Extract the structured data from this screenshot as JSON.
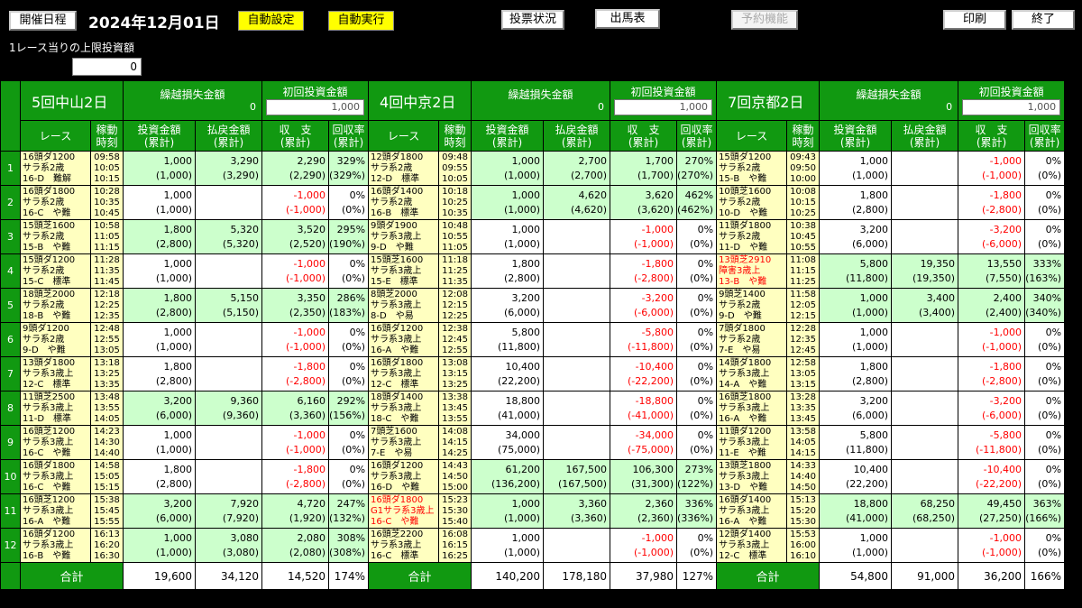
{
  "toolbar": {
    "schedule": "開催日程",
    "date": "2024年12月01日",
    "auto_set": "自動設定",
    "auto_run": "自動実行",
    "bet_status": "投票状況",
    "entries": "出馬表",
    "reserve": "予約機能",
    "print": "印刷",
    "exit": "終了",
    "limit_label": "1レース当りの上限投資額",
    "limit_value": "0"
  },
  "headers": {
    "carry_loss": "繰越損失金額",
    "first_bet": "初回投資金額",
    "race": "レース",
    "time": "稼動\n時刻",
    "invest": "投資金額\n(累計)",
    "payout": "払戻金額\n(累計)",
    "balance": "収　支\n(累計)",
    "rate": "回収率\n(累計)",
    "total": "合計"
  },
  "row_numbers": [
    "1",
    "2",
    "3",
    "4",
    "5",
    "6",
    "7",
    "8",
    "9",
    "10",
    "11",
    "12"
  ],
  "venues": [
    {
      "name": "5回中山2日",
      "carry": "0",
      "first": "1,000",
      "rows": [
        {
          "race": "16頭ダ1200\nサラ系2歳\n16-D　難解",
          "time": "09:58\n10:05\n10:15",
          "inv": "1,000\n(1,000)",
          "pay": "3,290\n(3,290)",
          "bal": "2,290\n(2,290)",
          "rate": "329%\n(329%)",
          "neg": false,
          "hit": true,
          "red": false
        },
        {
          "race": "16頭ダ1800\nサラ系2歳\n16-C　や難",
          "time": "10:28\n10:35\n10:45",
          "inv": "1,000\n(1,000)",
          "pay": "",
          "bal": "-1,000\n(-1,000)",
          "rate": "0%\n(0%)",
          "neg": true,
          "hit": false,
          "red": false
        },
        {
          "race": "15頭芝1600\nサラ系2歳\n15-B　や難",
          "time": "10:58\n11:05\n11:15",
          "inv": "1,800\n(2,800)",
          "pay": "5,320\n(5,320)",
          "bal": "3,520\n(2,520)",
          "rate": "295%\n(190%)",
          "neg": false,
          "hit": true,
          "red": false
        },
        {
          "race": "15頭ダ1200\nサラ系2歳\n15-C　標準",
          "time": "11:28\n11:35\n11:45",
          "inv": "1,000\n(1,000)",
          "pay": "",
          "bal": "-1,000\n(-1,000)",
          "rate": "0%\n(0%)",
          "neg": true,
          "hit": false,
          "red": false
        },
        {
          "race": "18頭芝2000\nサラ系2歳\n18-B　や難",
          "time": "12:18\n12:25\n12:35",
          "inv": "1,800\n(2,800)",
          "pay": "5,150\n(5,150)",
          "bal": "3,350\n(2,350)",
          "rate": "286%\n(183%)",
          "neg": false,
          "hit": true,
          "red": false
        },
        {
          "race": "9頭ダ1200\nサラ系2歳\n9-D　や難",
          "time": "12:48\n12:55\n13:05",
          "inv": "1,000\n(1,000)",
          "pay": "",
          "bal": "-1,000\n(-1,000)",
          "rate": "0%\n(0%)",
          "neg": true,
          "hit": false,
          "red": false
        },
        {
          "race": "13頭ダ1800\nサラ系3歳上\n12-C　標準",
          "time": "13:18\n13:25\n13:35",
          "inv": "1,800\n(2,800)",
          "pay": "",
          "bal": "-1,800\n(-2,800)",
          "rate": "0%\n(0%)",
          "neg": true,
          "hit": false,
          "red": false
        },
        {
          "race": "11頭芝2500\nサラ系3歳上\n11-D　標準",
          "time": "13:48\n13:55\n14:05",
          "inv": "3,200\n(6,000)",
          "pay": "9,360\n(9,360)",
          "bal": "6,160\n(3,360)",
          "rate": "292%\n(156%)",
          "neg": false,
          "hit": true,
          "red": false
        },
        {
          "race": "16頭芝1200\nサラ系3歳上\n16-C　や難",
          "time": "14:23\n14:30\n14:40",
          "inv": "1,000\n(1,000)",
          "pay": "",
          "bal": "-1,000\n(-1,000)",
          "rate": "0%\n(0%)",
          "neg": true,
          "hit": false,
          "red": false
        },
        {
          "race": "16頭ダ1800\nサラ系3歳上\n16-C　や難",
          "time": "14:58\n15:05\n15:15",
          "inv": "1,800\n(2,800)",
          "pay": "",
          "bal": "-1,800\n(-2,800)",
          "rate": "0%\n(0%)",
          "neg": true,
          "hit": false,
          "red": false
        },
        {
          "race": "16頭芝1200\nサラ系3歳上\n16-A　や難",
          "time": "15:38\n15:45\n15:55",
          "inv": "3,200\n(6,000)",
          "pay": "7,920\n(7,920)",
          "bal": "4,720\n(1,920)",
          "rate": "247%\n(132%)",
          "neg": false,
          "hit": true,
          "red": false
        },
        {
          "race": "16頭ダ1200\nサラ系3歳上\n16-B　や難",
          "time": "16:13\n16:20\n16:30",
          "inv": "1,000\n(1,000)",
          "pay": "3,080\n(3,080)",
          "bal": "2,080\n(2,080)",
          "rate": "308%\n(308%)",
          "neg": false,
          "hit": true,
          "red": false
        }
      ],
      "totals": {
        "inv": "19,600",
        "pay": "34,120",
        "bal": "14,520",
        "rate": "174%"
      }
    },
    {
      "name": "4回中京2日",
      "carry": "0",
      "first": "1,000",
      "rows": [
        {
          "race": "12頭ダ1800\nサラ系2歳\n12-D　標準",
          "time": "09:48\n09:55\n10:05",
          "inv": "1,000\n(1,000)",
          "pay": "2,700\n(2,700)",
          "bal": "1,700\n(1,700)",
          "rate": "270%\n(270%)",
          "neg": false,
          "hit": true,
          "red": false
        },
        {
          "race": "16頭ダ1400\nサラ系2歳\n16-B　標準",
          "time": "10:18\n10:25\n10:35",
          "inv": "1,000\n(1,000)",
          "pay": "4,620\n(4,620)",
          "bal": "3,620\n(3,620)",
          "rate": "462%\n(462%)",
          "neg": false,
          "hit": true,
          "red": false
        },
        {
          "race": "9頭ダ1900\nサラ系3歳上\n9-D　や難",
          "time": "10:48\n10:55\n11:05",
          "inv": "1,000\n(1,000)",
          "pay": "",
          "bal": "-1,000\n(-1,000)",
          "rate": "0%\n(0%)",
          "neg": true,
          "hit": false,
          "red": false
        },
        {
          "race": "15頭芝1600\nサラ系3歳上\n15-E　標準",
          "time": "11:18\n11:25\n11:35",
          "inv": "1,800\n(2,800)",
          "pay": "",
          "bal": "-1,800\n(-2,800)",
          "rate": "0%\n(0%)",
          "neg": true,
          "hit": false,
          "red": false
        },
        {
          "race": "8頭芝2000\nサラ系3歳上\n8-D　や易",
          "time": "12:08\n12:15\n12:25",
          "inv": "3,200\n(6,000)",
          "pay": "",
          "bal": "-3,200\n(-6,000)",
          "rate": "0%\n(0%)",
          "neg": true,
          "hit": false,
          "red": false
        },
        {
          "race": "16頭ダ1200\nサラ系3歳上\n16-A　や難",
          "time": "12:38\n12:45\n12:55",
          "inv": "5,800\n(11,800)",
          "pay": "",
          "bal": "-5,800\n(-11,800)",
          "rate": "0%\n(0%)",
          "neg": true,
          "hit": false,
          "red": false
        },
        {
          "race": "16頭ダ1800\nサラ系3歳上\n12-C　標準",
          "time": "13:08\n13:15\n13:25",
          "inv": "10,400\n(22,200)",
          "pay": "",
          "bal": "-10,400\n(-22,200)",
          "rate": "0%\n(0%)",
          "neg": true,
          "hit": false,
          "red": false
        },
        {
          "race": "18頭ダ1400\nサラ系3歳上\n18-C　や難",
          "time": "13:38\n13:45\n13:55",
          "inv": "18,800\n(41,000)",
          "pay": "",
          "bal": "-18,800\n(-41,000)",
          "rate": "0%\n(0%)",
          "neg": true,
          "hit": false,
          "red": false
        },
        {
          "race": "7頭芝1600\nサラ系3歳上\n7-E　や易",
          "time": "14:08\n14:15\n14:25",
          "inv": "34,000\n(75,000)",
          "pay": "",
          "bal": "-34,000\n(-75,000)",
          "rate": "0%\n(0%)",
          "neg": true,
          "hit": false,
          "red": false
        },
        {
          "race": "16頭ダ1200\nサラ系3歳上\n16-D　や難",
          "time": "14:43\n14:50\n15:00",
          "inv": "61,200\n(136,200)",
          "pay": "167,500\n(167,500)",
          "bal": "106,300\n(31,300)",
          "rate": "273%\n(122%)",
          "neg": false,
          "hit": true,
          "red": false
        },
        {
          "race": "16頭ダ1800\nG1サラ系3歳上\n16-C　や難",
          "time": "15:23\n15:30\n15:40",
          "inv": "1,000\n(1,000)",
          "pay": "3,360\n(3,360)",
          "bal": "2,360\n(2,360)",
          "rate": "336%\n(336%)",
          "neg": false,
          "hit": true,
          "red": true
        },
        {
          "race": "16頭芝2200\nサラ系3歳上\n16-C　標準",
          "time": "16:08\n16:15\n16:25",
          "inv": "1,000\n(1,000)",
          "pay": "",
          "bal": "-1,000\n(-1,000)",
          "rate": "0%\n(0%)",
          "neg": true,
          "hit": false,
          "red": false
        }
      ],
      "totals": {
        "inv": "140,200",
        "pay": "178,180",
        "bal": "37,980",
        "rate": "127%"
      }
    },
    {
      "name": "7回京都2日",
      "carry": "0",
      "first": "1,000",
      "rows": [
        {
          "race": "15頭ダ1200\nサラ系2歳\n15-B　や難",
          "time": "09:43\n09:50\n10:00",
          "inv": "1,000\n(1,000)",
          "pay": "",
          "bal": "-1,000\n(-1,000)",
          "rate": "0%\n(0%)",
          "neg": true,
          "hit": false,
          "red": false
        },
        {
          "race": "10頭芝1600\nサラ系2歳\n10-D　や難",
          "time": "10:08\n10:15\n10:25",
          "inv": "1,800\n(2,800)",
          "pay": "",
          "bal": "-1,800\n(-2,800)",
          "rate": "0%\n(0%)",
          "neg": true,
          "hit": false,
          "red": false
        },
        {
          "race": "11頭ダ1800\nサラ系2歳\n11-D　や難",
          "time": "10:38\n10:45\n10:55",
          "inv": "3,200\n(6,000)",
          "pay": "",
          "bal": "-3,200\n(-6,000)",
          "rate": "0%\n(0%)",
          "neg": true,
          "hit": false,
          "red": false
        },
        {
          "race": "13頭芝2910\n障害3歳上\n13-B　や難",
          "time": "11:08\n11:15\n11:25",
          "inv": "5,800\n(11,800)",
          "pay": "19,350\n(19,350)",
          "bal": "13,550\n(7,550)",
          "rate": "333%\n(163%)",
          "neg": false,
          "hit": true,
          "red": true
        },
        {
          "race": "9頭芝1400\nサラ系2歳\n9-D　や難",
          "time": "11:58\n12:05\n12:15",
          "inv": "1,000\n(1,000)",
          "pay": "3,400\n(3,400)",
          "bal": "2,400\n(2,400)",
          "rate": "340%\n(340%)",
          "neg": false,
          "hit": true,
          "red": false
        },
        {
          "race": "7頭ダ1800\nサラ系2歳\n7-E　や易",
          "time": "12:28\n12:35\n12:45",
          "inv": "1,000\n(1,000)",
          "pay": "",
          "bal": "-1,000\n(-1,000)",
          "rate": "0%\n(0%)",
          "neg": true,
          "hit": false,
          "red": false
        },
        {
          "race": "14頭ダ1800\nサラ系3歳上\n14-A　や難",
          "time": "12:58\n13:05\n13:15",
          "inv": "1,800\n(2,800)",
          "pay": "",
          "bal": "-1,800\n(-2,800)",
          "rate": "0%\n(0%)",
          "neg": true,
          "hit": false,
          "red": false
        },
        {
          "race": "16頭芝1800\nサラ系3歳上\n16-A　や難",
          "time": "13:28\n13:35\n13:45",
          "inv": "3,200\n(6,000)",
          "pay": "",
          "bal": "-3,200\n(-6,000)",
          "rate": "0%\n(0%)",
          "neg": true,
          "hit": false,
          "red": false
        },
        {
          "race": "11頭ダ1200\nサラ系3歳上\n11-E　や難",
          "time": "13:58\n14:05\n14:15",
          "inv": "5,800\n(11,800)",
          "pay": "",
          "bal": "-5,800\n(-11,800)",
          "rate": "0%\n(0%)",
          "neg": true,
          "hit": false,
          "red": false
        },
        {
          "race": "13頭芝1800\nサラ系3歳上\n13-D　や難",
          "time": "14:33\n14:40\n14:50",
          "inv": "10,400\n(22,200)",
          "pay": "",
          "bal": "-10,400\n(-22,200)",
          "rate": "0%\n(0%)",
          "neg": true,
          "hit": false,
          "red": false
        },
        {
          "race": "16頭ダ1400\nサラ系3歳上\n16-A　や難",
          "time": "15:13\n15:20\n15:30",
          "inv": "18,800\n(41,000)",
          "pay": "68,250\n(68,250)",
          "bal": "49,450\n(27,250)",
          "rate": "363%\n(166%)",
          "neg": false,
          "hit": true,
          "red": false
        },
        {
          "race": "12頭ダ1400\nサラ系3歳上\n12-C　標準",
          "time": "15:53\n16:00\n16:10",
          "inv": "1,000\n(1,000)",
          "pay": "",
          "bal": "-1,000\n(-1,000)",
          "rate": "0%\n(0%)",
          "neg": true,
          "hit": false,
          "red": false
        }
      ],
      "totals": {
        "inv": "54,800",
        "pay": "91,000",
        "bal": "36,200",
        "rate": "166%"
      }
    }
  ]
}
